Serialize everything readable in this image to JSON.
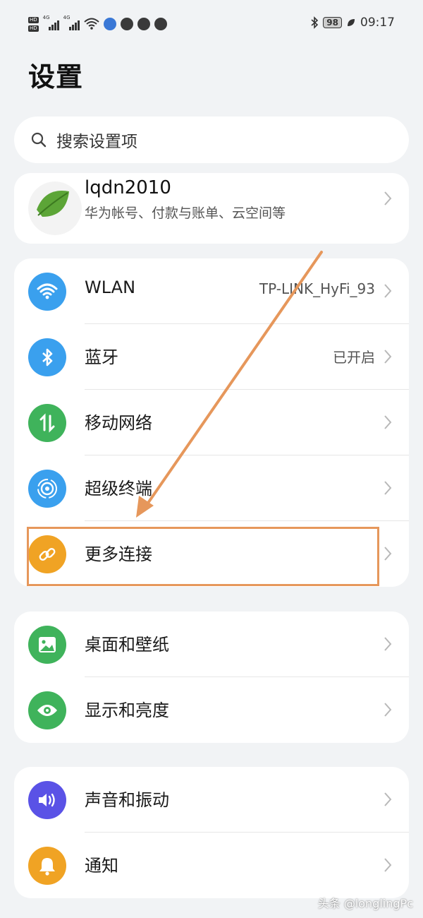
{
  "status_bar": {
    "hd1": "HD",
    "hd2": "HD",
    "net1": "4G",
    "net2": "4G",
    "battery": "98",
    "time": "09:17"
  },
  "page": {
    "title": "设置"
  },
  "search": {
    "placeholder": "搜索设置项"
  },
  "account": {
    "name": "lqdn2010",
    "subtitle": "华为帐号、付款与账单、云空间等"
  },
  "groups": [
    {
      "items": [
        {
          "label": "WLAN",
          "value": "TP-LINK_HyFi_93",
          "icon": "wifi-icon",
          "color": "#3aa0ee"
        },
        {
          "label": "蓝牙",
          "value": "已开启",
          "icon": "bluetooth-icon",
          "color": "#3aa0ee"
        },
        {
          "label": "移动网络",
          "value": "",
          "icon": "mobile-data-icon",
          "color": "#3fb35b"
        },
        {
          "label": "超级终端",
          "value": "",
          "icon": "super-device-icon",
          "color": "#3aa0ee"
        },
        {
          "label": "更多连接",
          "value": "",
          "icon": "link-icon",
          "color": "#f0a324"
        }
      ]
    },
    {
      "items": [
        {
          "label": "桌面和壁纸",
          "value": "",
          "icon": "wallpaper-icon",
          "color": "#3fb35b"
        },
        {
          "label": "显示和亮度",
          "value": "",
          "icon": "eye-icon",
          "color": "#3fb35b"
        }
      ]
    },
    {
      "items": [
        {
          "label": "声音和振动",
          "value": "",
          "icon": "sound-icon",
          "color": "#5a52e6"
        },
        {
          "label": "通知",
          "value": "",
          "icon": "bell-icon",
          "color": "#f0a324"
        }
      ]
    }
  ],
  "annotation": {
    "highlight_color": "#e6975b"
  },
  "watermark": "头条 @longlingPc"
}
